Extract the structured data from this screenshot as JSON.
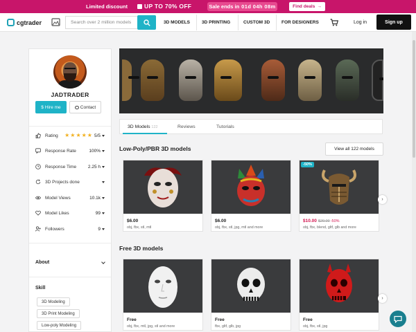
{
  "promo": {
    "limited": "Limited discount",
    "offer": "UP TO  70%  OFF",
    "sale_prefix": "Sale ends in",
    "sale_timer": "01d 04h 08m",
    "find_deals": "Find deals"
  },
  "header": {
    "logo": "cgtrader",
    "search_placeholder": "Search over 2 million models",
    "nav": [
      "3D MODELS",
      "3D PRINTING",
      "CUSTOM 3D",
      "FOR DESIGNERS"
    ],
    "login": "Log in",
    "signup": "Sign up"
  },
  "profile": {
    "username": "JADTRADER",
    "hire": "Hire me",
    "contact": "Contact",
    "stats": [
      {
        "label": "Rating",
        "value": "5/5",
        "stars": 5
      },
      {
        "label": "Response Rate",
        "value": "100%"
      },
      {
        "label": "Response Time",
        "value": "2.25 h"
      },
      {
        "label": "3D Projects done",
        "value": ""
      },
      {
        "label": "Model Views",
        "value": "10.1k"
      },
      {
        "label": "Model Likes",
        "value": "99"
      },
      {
        "label": "Followers",
        "value": "9"
      }
    ],
    "about": "About",
    "skill_title": "Skill",
    "skills": [
      "3D Modeling",
      "3D Print Modeling",
      "Low-poly Modeling"
    ]
  },
  "tabs": [
    {
      "label": "3D Models",
      "count": "122"
    },
    {
      "label": "Reviews",
      "count": ""
    },
    {
      "label": "Tutorials",
      "count": ""
    }
  ],
  "sections": {
    "lowpoly_title": "Low-Poly/PBR 3D models",
    "view_all": "View all 122 models",
    "free_title": "Free 3D models"
  },
  "lowpoly_cards": [
    {
      "price": "$6.00",
      "formats": "obj, fbx, stl, mtl"
    },
    {
      "price": "$6.00",
      "formats": "obj, fbx, stl, jpg, mtl and more"
    },
    {
      "price": "$10.00",
      "old_price": "$20.00",
      "discount": "-50%",
      "badge": "-50%",
      "formats": "obj, fbx, blend, gltf, glb and more"
    }
  ],
  "free_cards": [
    {
      "price": "Free",
      "formats": "obj, fbx, mtl, jpg, stl and more"
    },
    {
      "price": "Free",
      "formats": "fbx, gltf, glb, jpg"
    },
    {
      "price": "Free",
      "formats": "obj, fbx, stl, jpg"
    }
  ],
  "colors": {
    "accent": "#1fb3c7",
    "promo": "#c8156a",
    "sale_price": "#d3154f",
    "star": "#f2b01e"
  }
}
